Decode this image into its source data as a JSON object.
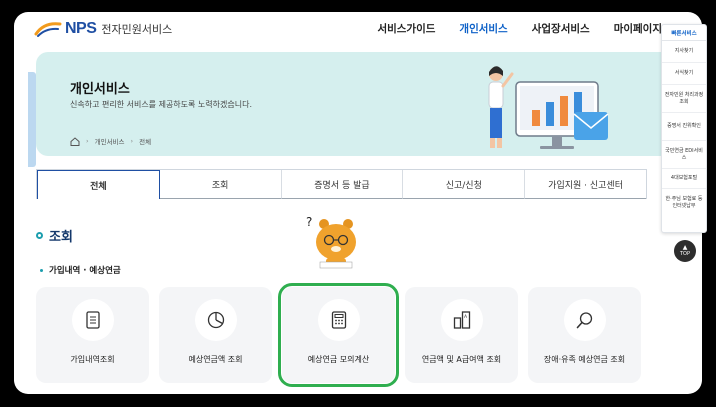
{
  "header": {
    "logo_mark": "NPS",
    "logo_sub": "전자민원서비스",
    "nav": [
      "서비스가이드",
      "개인서비스",
      "사업장서비스",
      "마이페이지"
    ],
    "nav_active_index": 1
  },
  "hero": {
    "title": "개인서비스",
    "description": "신속하고 편리한 서비스를 제공하도록 노력하겠습니다.",
    "breadcrumb": [
      "개인서비스",
      "전체"
    ]
  },
  "tabs": [
    "전체",
    "조회",
    "증명서 등 발급",
    "신고/신청",
    "가입지원 · 신고센터"
  ],
  "active_tab_index": 0,
  "section": {
    "title": "조회",
    "subtitle": "가입내역 · 예상연금"
  },
  "cards": [
    {
      "label": "가입내역조회",
      "icon": "document-list-icon"
    },
    {
      "label": "예상연금액 조회",
      "icon": "pie-chart-icon"
    },
    {
      "label": "예상연금 모의계산",
      "icon": "calculator-icon",
      "highlighted": true
    },
    {
      "label": "연금액 및 A급여액 조회",
      "icon": "bar-document-icon"
    },
    {
      "label": "장애·유족 예상연금 조회",
      "icon": "magnifier-icon"
    }
  ],
  "quick_menu": {
    "title": "빠른서비스",
    "items": [
      "지사찾기",
      "서식찾기",
      "전자민원 처리과정조회",
      "증명서 진위확인",
      "국민연금 EDI서비스",
      "4대보험포털",
      "한·주님 보험료 등 인터넷납부"
    ]
  },
  "top_button": "TOP",
  "colors": {
    "brand": "#1f4fa3",
    "active_nav": "#0f62c8",
    "hero_bg": "#d5efee",
    "highlight": "#2fae4f",
    "accent": "#1c9eae"
  }
}
